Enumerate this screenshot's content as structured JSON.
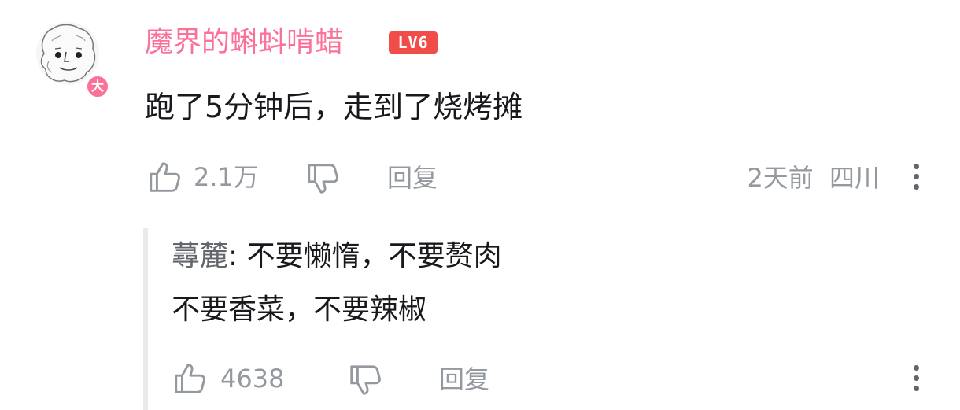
{
  "comment": {
    "username": "魔界的蝌蚪啃蜡",
    "level_badge": "LV6",
    "avatar_badge": "大",
    "text": "跑了5分钟后，走到了烧烤摊",
    "likes": "2.1万",
    "reply_label": "回复",
    "time": "2天前",
    "location": "四川"
  },
  "reply": {
    "author": "蕁麓",
    "line1": ": 不要懒惰，不要赘肉",
    "line2": "不要香菜，不要辣椒",
    "likes": "4638",
    "reply_label": "回复"
  },
  "icons": {
    "like": "thumbs-up-icon",
    "dislike": "thumbs-down-icon",
    "more": "more-vertical-icon"
  },
  "colors": {
    "username": "#fb7299",
    "level_badge": "#f04c49",
    "muted": "#9499a0",
    "text": "#18191c"
  }
}
